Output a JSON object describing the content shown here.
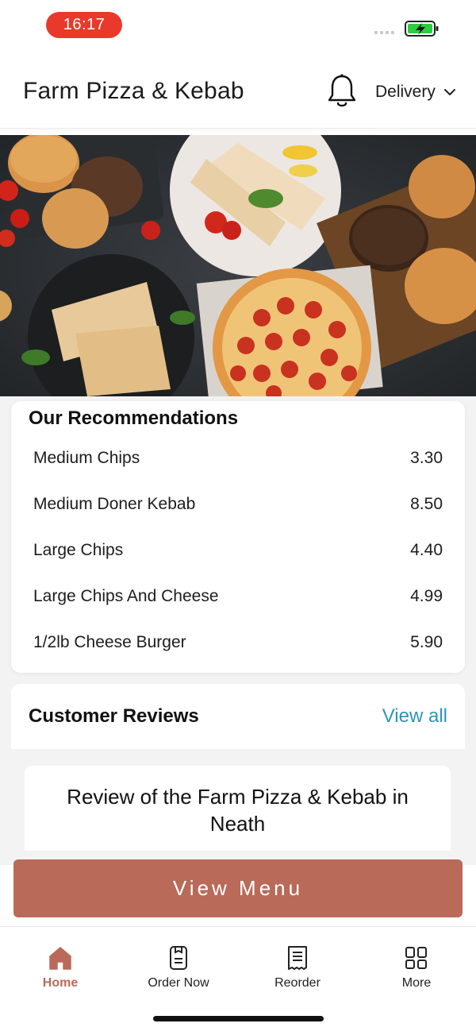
{
  "status_bar": {
    "time": "16:17"
  },
  "header": {
    "title": "Farm Pizza & Kebab",
    "mode": "Delivery"
  },
  "hero": {
    "description_icon": "food-banner-image"
  },
  "recommendations": {
    "title": "Our Recommendations",
    "items": [
      {
        "name": "Medium Chips",
        "price": "3.30"
      },
      {
        "name": "Medium Doner Kebab",
        "price": "8.50"
      },
      {
        "name": "Large Chips",
        "price": "4.40"
      },
      {
        "name": "Large Chips And Cheese",
        "price": "4.99"
      },
      {
        "name": "1/2lb Cheese Burger",
        "price": "5.90"
      }
    ]
  },
  "reviews": {
    "title": "Customer Reviews",
    "view_all": "View all",
    "review_heading": "Review of the Farm Pizza & Kebab in Neath"
  },
  "cta": {
    "label": "View Menu"
  },
  "nav": {
    "items": [
      {
        "label": "Home",
        "icon": "home-icon"
      },
      {
        "label": "Order Now",
        "icon": "order-icon"
      },
      {
        "label": "Reorder",
        "icon": "receipt-icon"
      },
      {
        "label": "More",
        "icon": "grid-icon"
      }
    ]
  },
  "colors": {
    "accent": "#b96a58",
    "link": "#2b95b8",
    "time_pill": "#e8392b"
  }
}
